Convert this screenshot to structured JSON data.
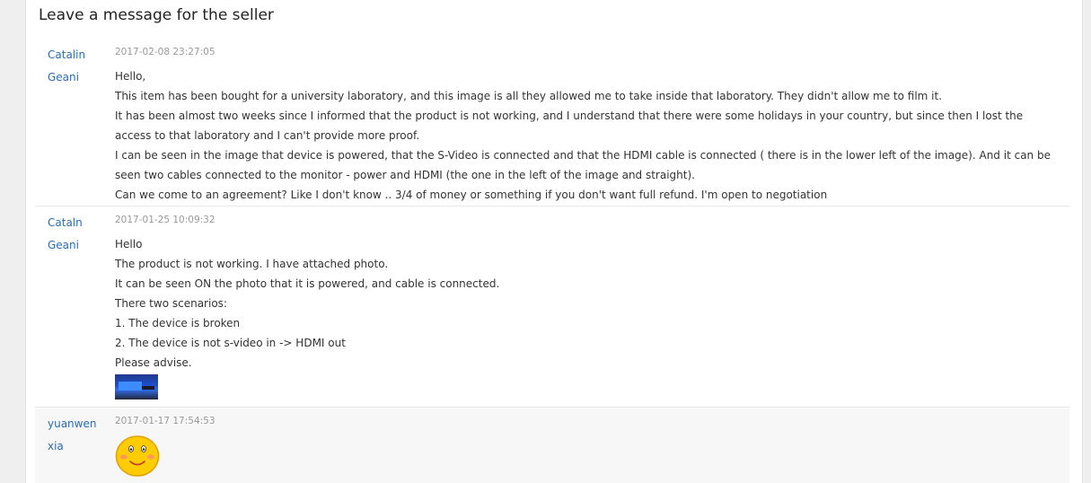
{
  "panel": {
    "title": "Leave a message for the seller"
  },
  "messages": [
    {
      "author": "Catalin Geani",
      "time": "2017-02-08 23:27:05",
      "lines": [
        "Hello,",
        "This item has been bought for a university laboratory, and this image is all they allowed me to take inside that laboratory. They didn't allow me to film it.",
        "It has been almost two weeks since I informed that the product is not working, and I understand that there were some holidays in your country, but since then I lost the access to that laboratory and I can't provide more proof.",
        "I can be seen in the image that device is powered, that the S-Video is connected and that the HDMI cable is connected ( there is in the lower left of the image). And it can be seen two cables connected to the monitor - power and HDMI (the one in the left of the image and straight).",
        "Can we come to an agreement? Like I don't know .. 3/4 of money or something if you don't want full refund. I'm open to negotiation"
      ]
    },
    {
      "author": "Cataln Geani",
      "time": "2017-01-25 10:09:32",
      "lines": [
        "Hello",
        "The product is not working. I have attached photo.",
        "It can be seen ON the photo that it is powered, and cable is connected.",
        "There two scenarios:",
        "1. The device is broken",
        "2. The device is not s-video in -> HDMI out",
        "Please advise."
      ],
      "attachment_icon": "photo-thumbnail"
    },
    {
      "author": "yuanwen xia",
      "time": "2017-01-17 17:54:53",
      "emoji_icon": "smiley-face"
    }
  ]
}
